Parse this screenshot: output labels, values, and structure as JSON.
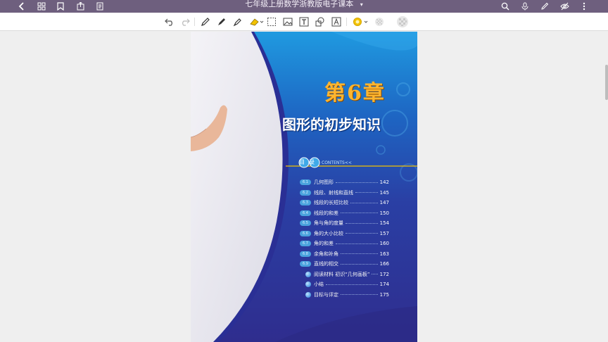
{
  "app": {
    "title": "七年级上册数学浙教版电子课本",
    "title_chevron_icon": "chevron-down-icon",
    "left_icons": [
      "back-icon",
      "grid-icon",
      "bookmark-icon",
      "share-icon",
      "document-icon"
    ],
    "right_icons": [
      "search-icon",
      "microphone-icon",
      "pencil-icon",
      "visibility-off-icon",
      "more-icon"
    ]
  },
  "toolbar": {
    "tools": [
      "undo-icon",
      "redo-icon",
      "pen-icon",
      "fountain-pen-icon",
      "highlighter-icon",
      "eraser-icon",
      "lasso-icon",
      "image-icon",
      "text-icon",
      "shapes-icon",
      "text-recognize-icon",
      "color-icon",
      "opacity-icon",
      "pattern-icon"
    ],
    "accent_color": "#f2c200"
  },
  "page": {
    "chapter": "第6章",
    "chapter_title": "图形的初步知识",
    "contents_label": "目录",
    "contents_en": "CONTENTS<<",
    "sections": [
      {
        "num": "6.1",
        "title": "几何图形",
        "page": "142"
      },
      {
        "num": "6.2",
        "title": "线段、射线和直线",
        "page": "145"
      },
      {
        "num": "6.3",
        "title": "线段的长短比较",
        "page": "147"
      },
      {
        "num": "6.4",
        "title": "线段的和差",
        "page": "150"
      },
      {
        "num": "6.5",
        "title": "角与角的度量",
        "page": "154"
      },
      {
        "num": "6.6",
        "title": "角的大小比较",
        "page": "157"
      },
      {
        "num": "6.7",
        "title": "角的和差",
        "page": "160"
      },
      {
        "num": "6.8",
        "title": "余角和补角",
        "page": "163"
      },
      {
        "num": "6.9",
        "title": "直线的相交",
        "page": "166"
      }
    ],
    "extras": [
      {
        "title": "阅读材料 初识“几何画板”",
        "page": "172"
      },
      {
        "title": "小结",
        "page": "174"
      },
      {
        "title": "目标与评定",
        "page": "175"
      }
    ]
  }
}
